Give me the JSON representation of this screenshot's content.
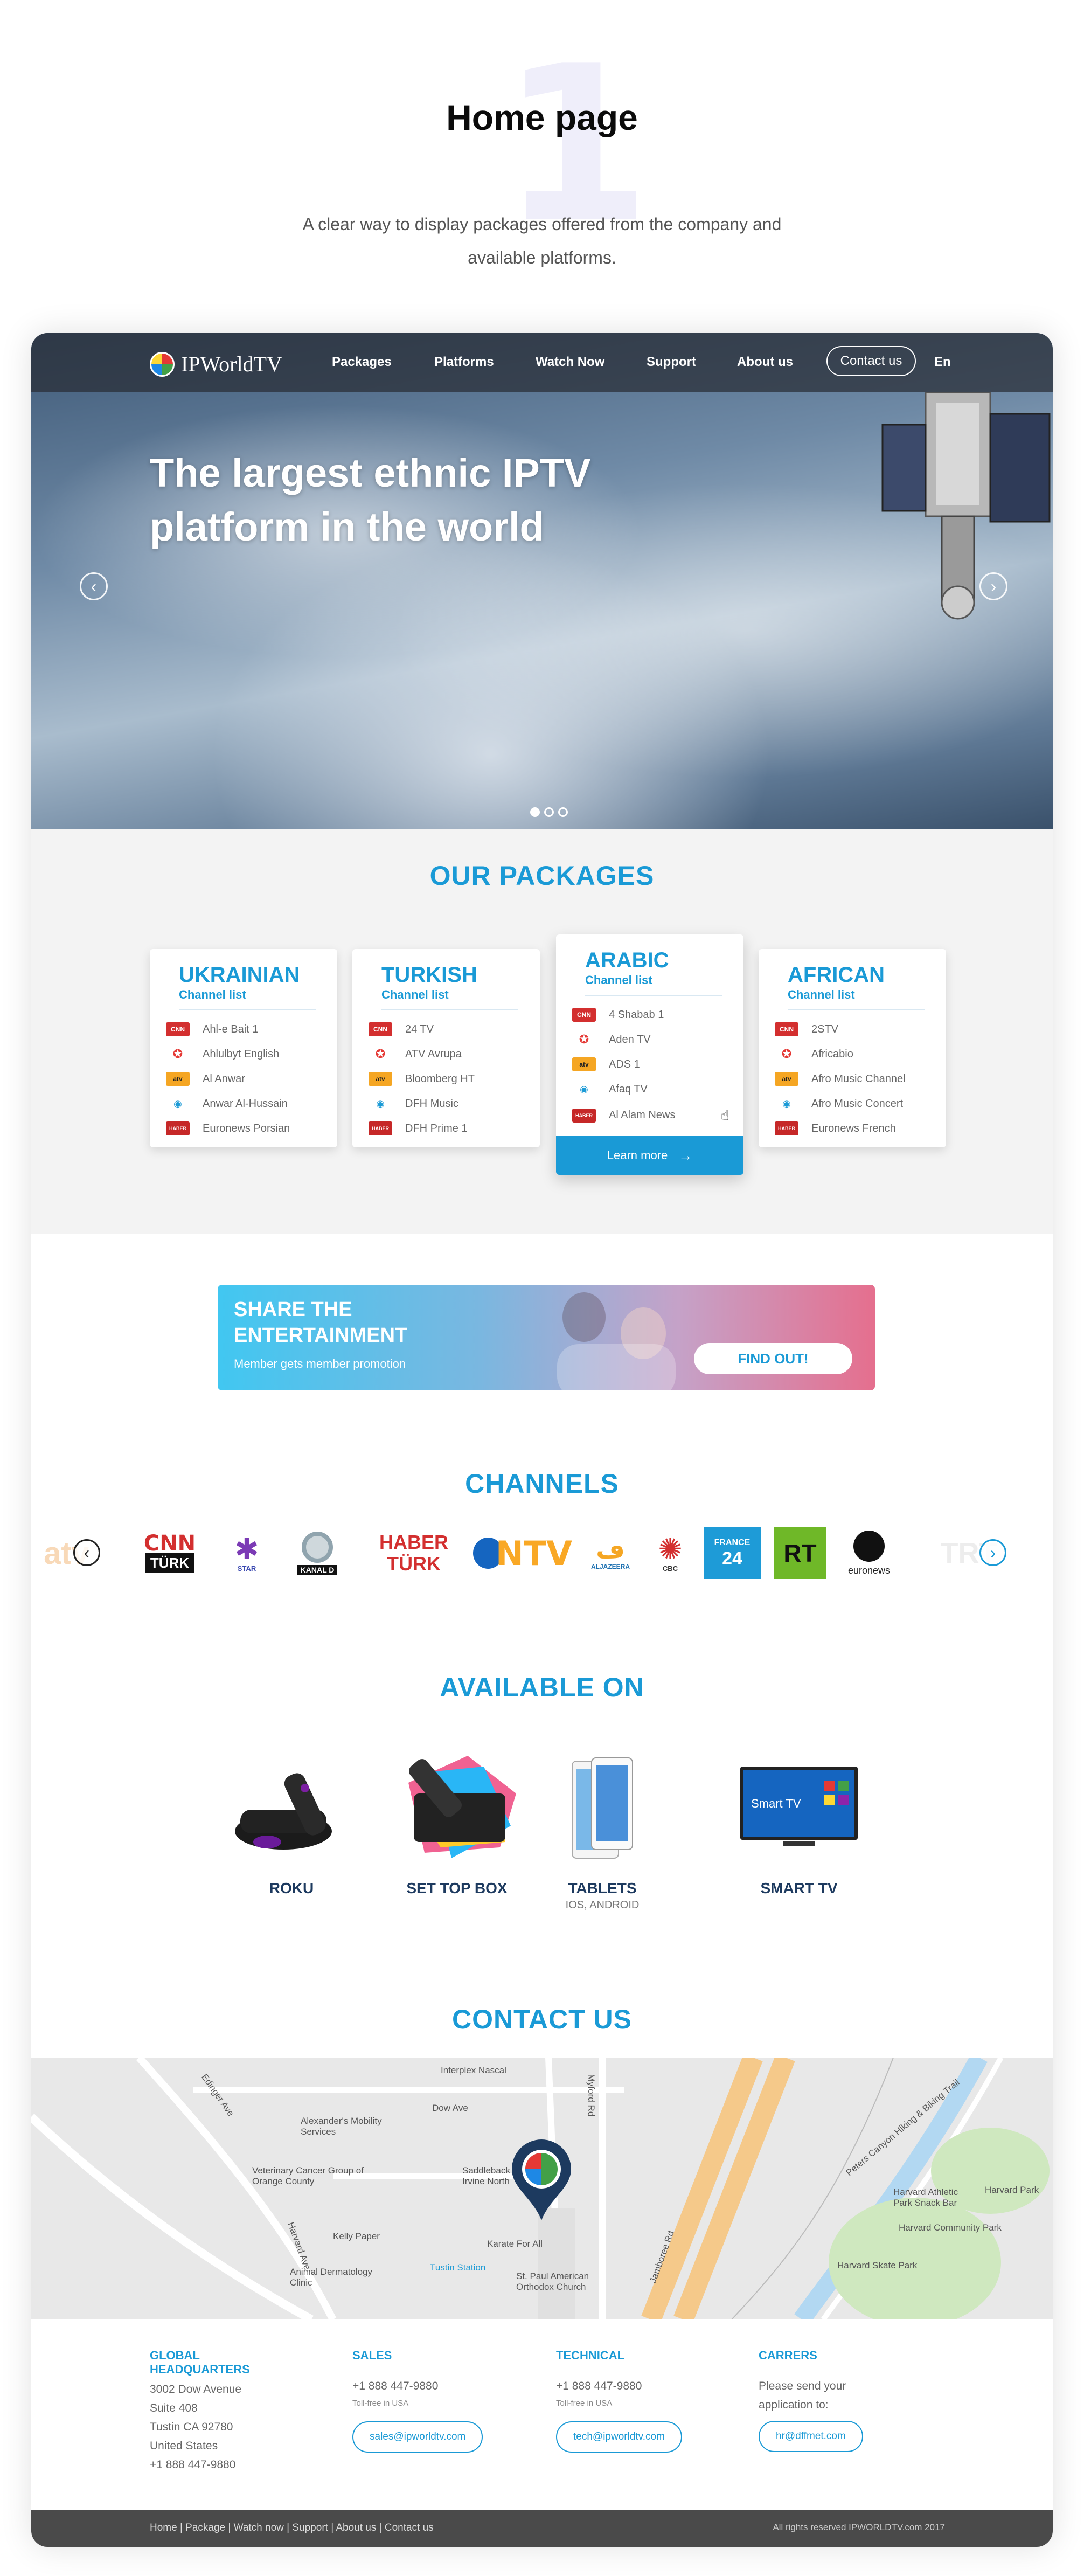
{
  "intro": {
    "number": "1",
    "title": "Home page",
    "description": "A clear way to display packages offered from the company and available platforms."
  },
  "navbar": {
    "logo": "IPWorldTV",
    "items": [
      "Packages",
      "Platforms",
      "Watch Now",
      "Support",
      "About us"
    ],
    "contact_label": "Contact us",
    "language": "En"
  },
  "hero": {
    "title": "The largest ethnic IPTV platform in the world",
    "slides_total": 3,
    "active_slide": 1
  },
  "packages": {
    "title": "OUR PACKAGES",
    "items": [
      {
        "name": "UKRAINIAN",
        "sub": "Channel list",
        "channels": [
          "Ahl-e Bait 1",
          "Ahlulbyt English",
          "Al Anwar",
          "Anwar Al-Hussain",
          "Euronews Porsian"
        ]
      },
      {
        "name": "TURKISH",
        "sub": "Channel list",
        "channels": [
          "24 TV",
          "ATV Avrupa",
          "Bloomberg HT",
          "DFH Music",
          "DFH Prime 1"
        ]
      },
      {
        "name": "ARABIC",
        "sub": "Channel list",
        "channels": [
          "4 Shabab 1",
          "Aden TV",
          "ADS 1",
          "Afaq TV",
          "Al Alam News"
        ],
        "button": "Learn more"
      },
      {
        "name": "AFRICAN",
        "sub": "Channel list",
        "channels": [
          "2STV",
          "Africabio",
          "Afro Music Channel",
          "Afro Music Concert",
          "Euronews French"
        ]
      }
    ]
  },
  "promo": {
    "title_line1": "SHARE THE",
    "title_line2": "ENTERTAINMENT",
    "subtitle": "Member gets member promotion",
    "button": "FIND OUT!"
  },
  "channels": {
    "title": "CHANNELS",
    "logos": [
      "atv",
      "CNN TÜRK",
      "STAR",
      "KANAL D",
      "HABER TÜRK",
      "NTV",
      "ALJAZEERA",
      "CBC",
      "FRANCE 24",
      "RT",
      "euronews",
      "TRT"
    ]
  },
  "platforms": {
    "title": "AVAILABLE ON",
    "items": [
      {
        "label": "ROKU",
        "sub": ""
      },
      {
        "label": "SET TOP BOX",
        "sub": ""
      },
      {
        "label": "TABLETS",
        "sub": "IOS, ANDROID"
      },
      {
        "label": "SMART TV",
        "sub": ""
      }
    ],
    "smart_tv_screen": "Smart TV"
  },
  "contact": {
    "title": "CONTACT US",
    "map_labels": [
      "Interplex Nascal",
      "Alexander's Mobility Services",
      "Veterinary Cancer Group of Orange County",
      "Saddleback Irvine North",
      "Kelly Paper",
      "Animal Dermatology Clinic",
      "Karate For All",
      "St. Paul American Orthodox Church",
      "Tustin Station",
      "Harvard Athletic Park Snack Bar",
      "Harvard Community Park",
      "Harvard Skate Park",
      "Harvard Park",
      "Jamboree Rd",
      "Dow Ave",
      "Edinger Ave",
      "Myford Rd",
      "Harvard Ave",
      "Peters Canyon Hiking & Biking Trail"
    ]
  },
  "footer": {
    "hq": {
      "heading_line1": "GLOBAL",
      "heading_line2": "HEADQUARTERS",
      "lines": [
        "3002 Dow Avenue",
        "Suite 408",
        "Tustin CA 92780",
        "United States",
        "+1 888 447-9880"
      ]
    },
    "sales": {
      "heading": "SALES",
      "phone": "+1 888 447-9880",
      "note": "Toll-free in USA",
      "email": "sales@ipworldtv.com"
    },
    "technical": {
      "heading": "TECHNICAL",
      "phone": "+1 888 447-9880",
      "note": "Toll-free in USA",
      "email": "tech@ipworldtv.com"
    },
    "careers": {
      "heading": "CARRERS",
      "line1": "Please send your",
      "line2": "application to:",
      "email": "hr@dffmet.com"
    },
    "links": "Home | Package | Watch now | Support | About us | Contact us",
    "copyright": "All rights reserved IPWORLDTV.com 2017"
  },
  "colors": {
    "accent": "#1a9ad6",
    "dark": "#4a4a4a",
    "promo_start": "#41c7f1",
    "promo_end": "#e56f8e"
  }
}
